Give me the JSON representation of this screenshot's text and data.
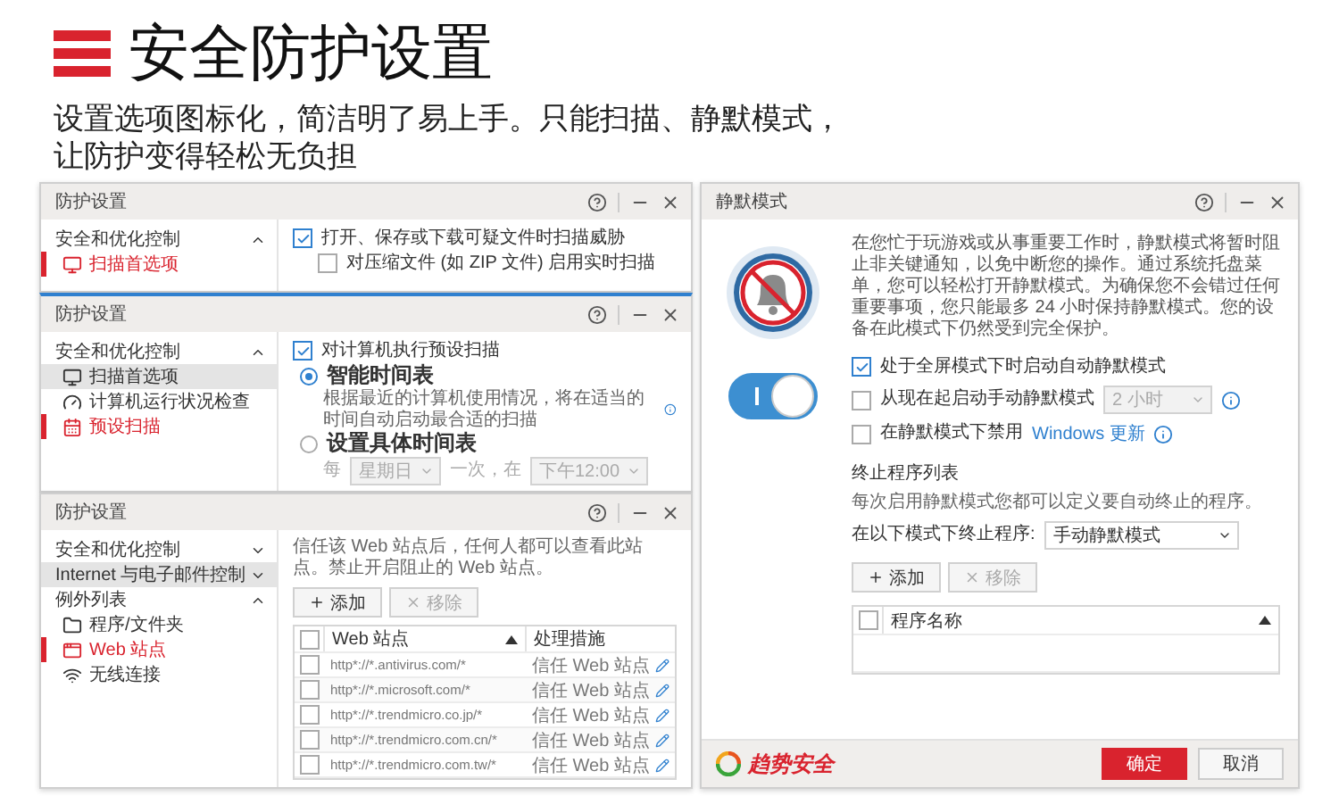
{
  "header": {
    "title": "安全防护设置",
    "subtitle": [
      "设置选项图标化，简洁明了易上手。只能扫描、静默模式，",
      "让防护变得轻松无负担"
    ]
  },
  "scan_window": {
    "title": "防护设置",
    "focused": false,
    "sidebar": [
      {
        "label": "安全和优化控制",
        "expanded": true,
        "highlighted": false,
        "children": [
          {
            "kind": "scan",
            "label": "扫描首选项",
            "selected": true,
            "highlighted": false
          }
        ]
      }
    ],
    "options": [
      {
        "label": "打开、保存或下载可疑文件时扫描威胁",
        "checked": true,
        "children": [
          {
            "label": "对压缩文件 (如 ZIP 文件) 启用实时扫描",
            "checked": false
          }
        ]
      }
    ]
  },
  "schedule_window": {
    "title": "防护设置",
    "focused": true,
    "sidebar": [
      {
        "label": "安全和优化控制",
        "expanded": true,
        "highlighted": false,
        "children": [
          {
            "kind": "scan",
            "label": "扫描首选项",
            "selected": false,
            "highlighted": true
          },
          {
            "kind": "health",
            "label": "计算机运行状况检查",
            "selected": false,
            "highlighted": false
          },
          {
            "kind": "schedule",
            "label": "预设扫描",
            "selected": true,
            "highlighted": false
          }
        ]
      }
    ],
    "scheduled_scan": {
      "label": "对计算机执行预设扫描",
      "checked": true
    },
    "schedules": [
      {
        "label": "智能时间表",
        "selected": true,
        "description": "根据最近的计算机使用情况，将在适当的时间自动启动最合适的扫描"
      },
      {
        "label": "设置具体时间表",
        "selected": false
      }
    ],
    "schedule_row": {
      "every": "每",
      "day": "星期日",
      "between": "一次，在",
      "time": "下午12:00"
    }
  },
  "exceptions_window": {
    "title": "防护设置",
    "focused": false,
    "sidebar": [
      {
        "label": "安全和优化控制",
        "expanded": false,
        "highlighted": false
      },
      {
        "label": "Internet 与电子邮件控制",
        "expanded": false,
        "highlighted": true
      },
      {
        "label": "例外列表",
        "expanded": true,
        "highlighted": false,
        "children": [
          {
            "kind": "folder",
            "label": "程序/文件夹",
            "selected": false,
            "highlighted": false
          },
          {
            "kind": "website",
            "label": "Web 站点",
            "selected": true,
            "highlighted": false
          },
          {
            "kind": "wireless",
            "label": "无线连接",
            "selected": false,
            "highlighted": false
          }
        ]
      }
    ],
    "description": "信任该 Web 站点后，任何人都可以查看此站点。禁止开启阻止的 Web 站点。",
    "buttons": [
      {
        "kind": "add",
        "label": "添加",
        "disabled": false
      },
      {
        "kind": "remove",
        "label": "移除",
        "disabled": true
      }
    ],
    "select_all_checked": false,
    "columns": [
      {
        "label": "Web 站点",
        "sorted_ascending": true
      },
      {
        "label": "处理措施"
      }
    ],
    "rows": [
      {
        "url": "http*://*.antivirus.com/*",
        "action": "信任 Web 站点",
        "checked": false
      },
      {
        "url": "http*://*.microsoft.com/*",
        "action": "信任 Web 站点",
        "checked": false
      },
      {
        "url": "http*://*.trendmicro.co.jp/*",
        "action": "信任 Web 站点",
        "checked": false
      },
      {
        "url": "http*://*.trendmicro.com.cn/*",
        "action": "信任 Web 站点",
        "checked": false
      },
      {
        "url": "http*://*.trendmicro.com.tw/*",
        "action": "信任 Web 站点",
        "checked": false
      }
    ]
  },
  "quiet_mode_window": {
    "title": "静默模式",
    "focused": false,
    "on": true,
    "description": "在您忙于玩游戏或从事重要工作时，静默模式将暂时阻止非关键通知，以免中断您的操作。通过系统托盘菜单，您可以轻松打开静默模式。为确保您不会错过任何重要事项，您只能最多 24 小时保持静默模式。您的设备在此模式下仍然受到完全保护。",
    "options": [
      {
        "kind": "plain",
        "label": "处于全屏模式下时启动自动静默模式",
        "checked": true
      },
      {
        "kind": "duration",
        "label": "从现在起启动手动静默模式",
        "checked": false,
        "select": {
          "value": "2 小时",
          "disabled": true
        }
      },
      {
        "kind": "link",
        "label": "在静默模式下禁用",
        "link": "Windows 更新",
        "checked": false
      }
    ],
    "terminate": {
      "title": "终止程序列表",
      "description": "每次启用静默模式您都可以定义要自动终止的程序。",
      "mode_label": "在以下模式下终止程序:",
      "mode": "手动静默模式",
      "buttons": [
        {
          "kind": "add",
          "label": "添加",
          "disabled": false
        },
        {
          "kind": "remove",
          "label": "移除",
          "disabled": true
        }
      ],
      "select_all_checked": false,
      "column": {
        "label": "程序名称",
        "sorted_ascending": true
      }
    },
    "footer": {
      "brand": "趋势安全",
      "buttons": [
        {
          "kind": "primary",
          "label": "确定"
        },
        {
          "kind": "secondary",
          "label": "取消"
        }
      ]
    }
  }
}
